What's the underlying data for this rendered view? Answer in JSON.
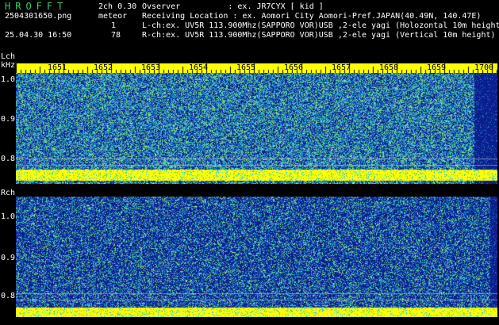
{
  "header": {
    "app_title": "HROFFT",
    "version": "2ch 0.30",
    "filename": "2504301650.png",
    "meteor_label": "meteor",
    "datetime": "25.04.30 16:50",
    "lch_count": "1",
    "rch_count": "78",
    "observer_line": "Ovserver          : ex. JR7CYX [ kid ]",
    "location_line": "Receiving Location : ex. Aomori City Aomori-Pref.JAPAN(40.49N, 140.47E)",
    "lch_line": "L-ch:ex. UV5R 113.900Mhz(SAPPORO VOR)USB ,2-ele yagi (Holozontal 10m height",
    "rch_line": "R-ch:ex. UV5R 113.900Mhz(SAPPORO VOR)USB ,2-ele yagi (Vertical 10m height)"
  },
  "lch": {
    "label": "Lch",
    "unit": "kHz",
    "ticks": [
      "1.0",
      "0.9",
      "0.8"
    ]
  },
  "rch": {
    "label": "Rch",
    "ticks": [
      "1.0",
      "0.9",
      "0.8"
    ]
  },
  "time_ruler": {
    "labels": [
      "1651",
      "1652",
      "1653",
      "1654",
      "1655",
      "1656",
      "1657",
      "1658",
      "1659",
      "1700"
    ]
  },
  "colors": {
    "background": "#000000",
    "header_green": "#2fd06a",
    "ruler_yellow": "#ffff00",
    "noise_base": "#0a1e8c",
    "noise_mid": "#1e78c8",
    "noise_hi": "#3cc8b4",
    "band_yellow": "#ffff00"
  }
}
